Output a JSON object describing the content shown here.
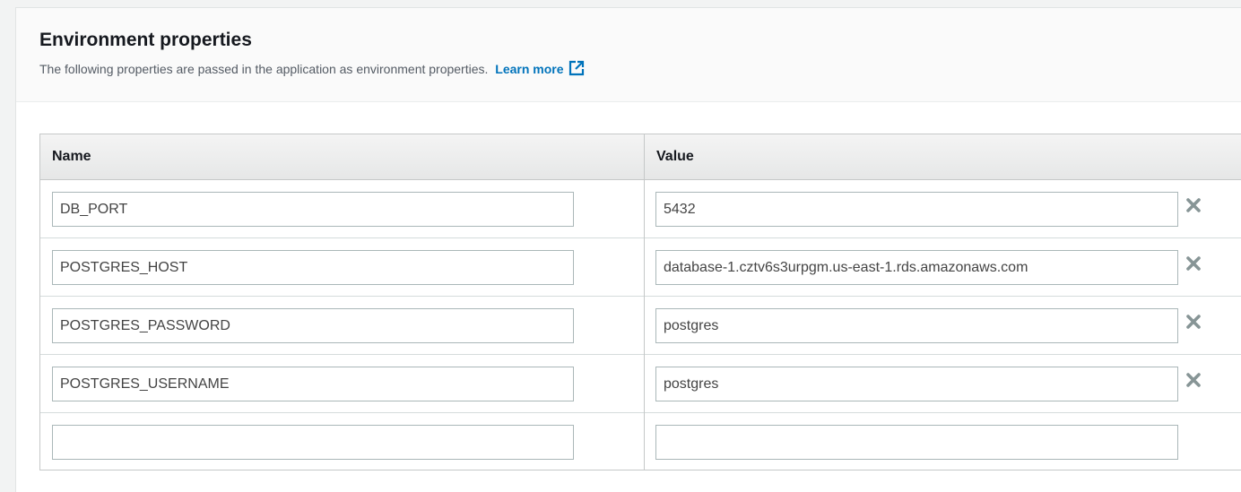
{
  "header": {
    "title": "Environment properties",
    "description": "The following properties are passed in the application as environment properties.",
    "learn_more": "Learn more",
    "external_icon": "external-link-icon"
  },
  "table": {
    "columns": {
      "name": "Name",
      "value": "Value"
    },
    "rows": [
      {
        "name": "DB_PORT",
        "value": "5432"
      },
      {
        "name": "POSTGRES_HOST",
        "value": "database-1.cztv6s3urpgm.us-east-1.rds.amazonaws.com"
      },
      {
        "name": "POSTGRES_PASSWORD",
        "value": "postgres"
      },
      {
        "name": "POSTGRES_USERNAME",
        "value": "postgres"
      },
      {
        "name": "",
        "value": ""
      }
    ],
    "remove_icon": "close-icon"
  },
  "colors": {
    "link": "#0073bb",
    "remove_icon": "#879596",
    "border": "#aab7b8"
  }
}
